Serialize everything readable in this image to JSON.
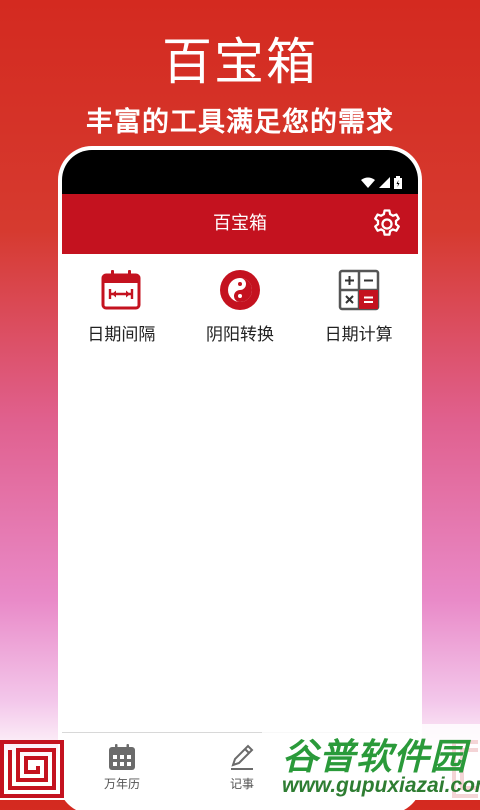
{
  "promo": {
    "title": "百宝箱",
    "subtitle": "丰富的工具满足您的需求"
  },
  "app": {
    "header_title": "百宝箱",
    "accent_color": "#c4121f",
    "tools": [
      {
        "label": "日期间隔",
        "icon": "calendar-interval-icon"
      },
      {
        "label": "阴阳转换",
        "icon": "yin-yang-icon"
      },
      {
        "label": "日期计算",
        "icon": "calculator-icon"
      }
    ],
    "bottom_nav": [
      {
        "label": "万年历",
        "icon": "calendar-icon"
      },
      {
        "label": "记事",
        "icon": "pencil-icon"
      }
    ]
  },
  "watermark": {
    "logo_text": "谷普软件园",
    "url": "www.gupuxiazai.com"
  }
}
